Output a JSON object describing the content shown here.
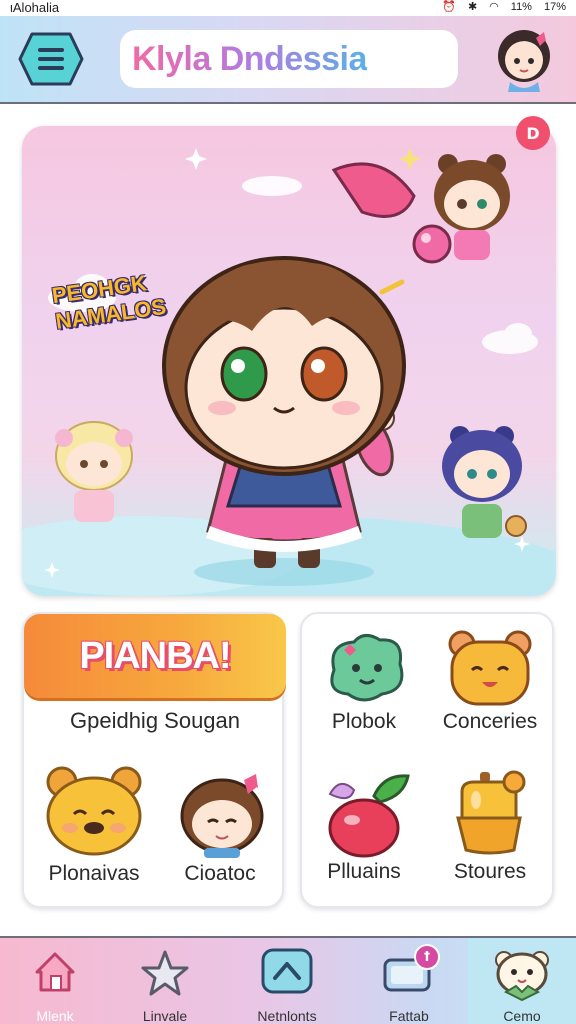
{
  "status_bar": {
    "left_text": "ιAlohalia",
    "battery_text": "11%",
    "signal_text": "17%"
  },
  "header": {
    "title": "Klyla Dndessia",
    "menu_icon": "menu-icon",
    "avatar": "profile-avatar"
  },
  "hero": {
    "logo_line1": "PEOHGK",
    "logo_line2": "NAMALOS",
    "badge_text": "D"
  },
  "left_panel": {
    "banner": "PIANBA!",
    "subtitle": "Gpeidhig Sougan",
    "tiles": [
      {
        "label": "Plonaivas",
        "icon": "bear-face-icon"
      },
      {
        "label": "Cioatoc",
        "icon": "chibi-girl-icon"
      }
    ]
  },
  "right_panel": {
    "tiles": [
      {
        "label": "Plobok",
        "icon": "green-blob-icon"
      },
      {
        "label": "Conceries",
        "icon": "yellow-bear-icon"
      },
      {
        "label": "Plluains",
        "icon": "apple-icon"
      },
      {
        "label": "Stoures",
        "icon": "honey-jar-icon"
      }
    ]
  },
  "bottom_nav": {
    "items": [
      {
        "label": "Mlenk",
        "icon": "home-icon"
      },
      {
        "label": "Linvale",
        "icon": "star-arrow-icon"
      },
      {
        "label": "Netnlonts",
        "icon": "chevron-up-icon"
      },
      {
        "label": "Fattab",
        "icon": "tv-icon",
        "badge": "ꝉ"
      },
      {
        "label": "Cemo",
        "icon": "mascot-icon"
      }
    ]
  },
  "colors": {
    "accent_pink": "#f06aa5",
    "accent_blue": "#5bb0e8",
    "banner_orange": "#f58a3a",
    "badge_red": "#f0506e"
  }
}
